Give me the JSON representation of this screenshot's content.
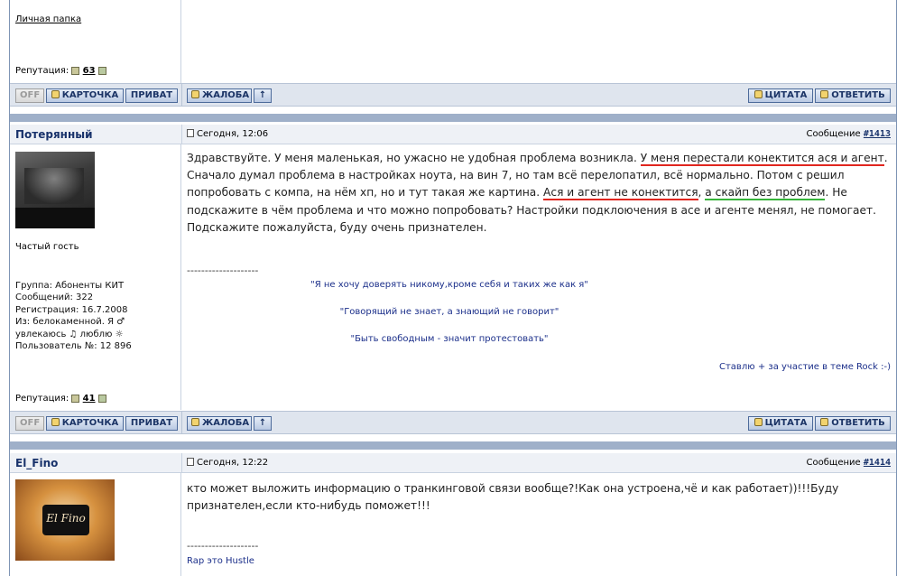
{
  "top": {
    "personal_folder": "Личная папка",
    "reputation_label": "Репутация:",
    "reputation_value": "63"
  },
  "buttons": {
    "off": "OFF",
    "card": "КАРТОЧКА",
    "private": "ПРИВАТ",
    "complaint": "ЖАЛОБА",
    "up": "↑",
    "quote": "ЦИТАТА",
    "reply": "ОТВЕТИТЬ"
  },
  "post1": {
    "author": "Потерянный",
    "date": "Сегодня, 12:06",
    "message_label": "Сообщение",
    "message_num": "#1413",
    "rank": "Частый гость",
    "info": {
      "group": "Группа: Абоненты КИТ",
      "messages": "Сообщений: 322",
      "registered": "Регистрация: 16.7.2008",
      "from": "Из: белокаменной. Я ♂",
      "likes": "увлекаюсь ♫ люблю ☼",
      "user_num": "Пользователь №: 12 896"
    },
    "reputation_label": "Репутация:",
    "reputation_value": "41",
    "text": {
      "s1": "Здравствуйте. У меня маленькая, но ужасно не удобная проблема возникла. ",
      "s2": "У меня перестали конектится ася и агент",
      "s3": ". Сначало думал проблема в настройках ноута, на вин 7, но там всё перелопатил, всё нормально. Потом с решил попробовать с компа, на нём хп, но и тут такая же картина. ",
      "s4": "Ася и агент не конектится",
      "s5": ", ",
      "s6": "а скайп без проблем",
      "s7": ". Не подскажите в чём проблема и что можно попробовать? Настройки подклоючения в асе и агенте менял, не помогает. Подскажите пожалуйста, буду очень признателен."
    },
    "signature": {
      "dashes": "--------------------",
      "line1": "\"Я не хочу доверять никому,кроме себя и таких же как я\"",
      "line2": "\"Говорящий не знает, а знающий не говорит\"",
      "line3": "\"Быть свободным - значит протестовать\"",
      "line4": "Ставлю + за участие в теме Rock :-)"
    }
  },
  "post2": {
    "author": "El_Fino",
    "date": "Сегодня, 12:22",
    "message_label": "Сообщение",
    "message_num": "#1414",
    "text": "кто может выложить информацию о транкинговой связи вообще?!Как она устроена,чё и как работает))!!!Буду признателен,если кто-нибудь поможет!!!",
    "signature": {
      "dashes": "--------------------",
      "line1": "Rap это Hustle"
    },
    "avatar_text": "El Fino"
  },
  "colors": {
    "accent": "#18326b",
    "red_underline": "#e0261f",
    "green_underline": "#36b43a"
  }
}
